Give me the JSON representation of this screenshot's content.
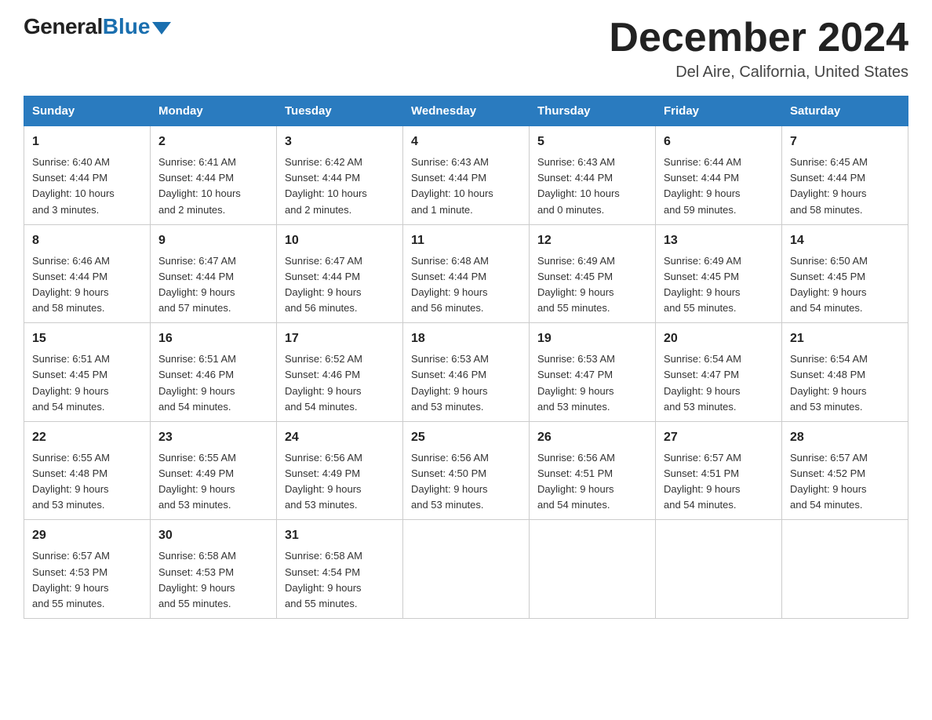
{
  "header": {
    "logo_general": "General",
    "logo_blue": "Blue",
    "month_title": "December 2024",
    "location": "Del Aire, California, United States"
  },
  "days_of_week": [
    "Sunday",
    "Monday",
    "Tuesday",
    "Wednesday",
    "Thursday",
    "Friday",
    "Saturday"
  ],
  "weeks": [
    [
      {
        "day": "1",
        "sunrise": "6:40 AM",
        "sunset": "4:44 PM",
        "daylight": "10 hours and 3 minutes."
      },
      {
        "day": "2",
        "sunrise": "6:41 AM",
        "sunset": "4:44 PM",
        "daylight": "10 hours and 2 minutes."
      },
      {
        "day": "3",
        "sunrise": "6:42 AM",
        "sunset": "4:44 PM",
        "daylight": "10 hours and 2 minutes."
      },
      {
        "day": "4",
        "sunrise": "6:43 AM",
        "sunset": "4:44 PM",
        "daylight": "10 hours and 1 minute."
      },
      {
        "day": "5",
        "sunrise": "6:43 AM",
        "sunset": "4:44 PM",
        "daylight": "10 hours and 0 minutes."
      },
      {
        "day": "6",
        "sunrise": "6:44 AM",
        "sunset": "4:44 PM",
        "daylight": "9 hours and 59 minutes."
      },
      {
        "day": "7",
        "sunrise": "6:45 AM",
        "sunset": "4:44 PM",
        "daylight": "9 hours and 58 minutes."
      }
    ],
    [
      {
        "day": "8",
        "sunrise": "6:46 AM",
        "sunset": "4:44 PM",
        "daylight": "9 hours and 58 minutes."
      },
      {
        "day": "9",
        "sunrise": "6:47 AM",
        "sunset": "4:44 PM",
        "daylight": "9 hours and 57 minutes."
      },
      {
        "day": "10",
        "sunrise": "6:47 AM",
        "sunset": "4:44 PM",
        "daylight": "9 hours and 56 minutes."
      },
      {
        "day": "11",
        "sunrise": "6:48 AM",
        "sunset": "4:44 PM",
        "daylight": "9 hours and 56 minutes."
      },
      {
        "day": "12",
        "sunrise": "6:49 AM",
        "sunset": "4:45 PM",
        "daylight": "9 hours and 55 minutes."
      },
      {
        "day": "13",
        "sunrise": "6:49 AM",
        "sunset": "4:45 PM",
        "daylight": "9 hours and 55 minutes."
      },
      {
        "day": "14",
        "sunrise": "6:50 AM",
        "sunset": "4:45 PM",
        "daylight": "9 hours and 54 minutes."
      }
    ],
    [
      {
        "day": "15",
        "sunrise": "6:51 AM",
        "sunset": "4:45 PM",
        "daylight": "9 hours and 54 minutes."
      },
      {
        "day": "16",
        "sunrise": "6:51 AM",
        "sunset": "4:46 PM",
        "daylight": "9 hours and 54 minutes."
      },
      {
        "day": "17",
        "sunrise": "6:52 AM",
        "sunset": "4:46 PM",
        "daylight": "9 hours and 54 minutes."
      },
      {
        "day": "18",
        "sunrise": "6:53 AM",
        "sunset": "4:46 PM",
        "daylight": "9 hours and 53 minutes."
      },
      {
        "day": "19",
        "sunrise": "6:53 AM",
        "sunset": "4:47 PM",
        "daylight": "9 hours and 53 minutes."
      },
      {
        "day": "20",
        "sunrise": "6:54 AM",
        "sunset": "4:47 PM",
        "daylight": "9 hours and 53 minutes."
      },
      {
        "day": "21",
        "sunrise": "6:54 AM",
        "sunset": "4:48 PM",
        "daylight": "9 hours and 53 minutes."
      }
    ],
    [
      {
        "day": "22",
        "sunrise": "6:55 AM",
        "sunset": "4:48 PM",
        "daylight": "9 hours and 53 minutes."
      },
      {
        "day": "23",
        "sunrise": "6:55 AM",
        "sunset": "4:49 PM",
        "daylight": "9 hours and 53 minutes."
      },
      {
        "day": "24",
        "sunrise": "6:56 AM",
        "sunset": "4:49 PM",
        "daylight": "9 hours and 53 minutes."
      },
      {
        "day": "25",
        "sunrise": "6:56 AM",
        "sunset": "4:50 PM",
        "daylight": "9 hours and 53 minutes."
      },
      {
        "day": "26",
        "sunrise": "6:56 AM",
        "sunset": "4:51 PM",
        "daylight": "9 hours and 54 minutes."
      },
      {
        "day": "27",
        "sunrise": "6:57 AM",
        "sunset": "4:51 PM",
        "daylight": "9 hours and 54 minutes."
      },
      {
        "day": "28",
        "sunrise": "6:57 AM",
        "sunset": "4:52 PM",
        "daylight": "9 hours and 54 minutes."
      }
    ],
    [
      {
        "day": "29",
        "sunrise": "6:57 AM",
        "sunset": "4:53 PM",
        "daylight": "9 hours and 55 minutes."
      },
      {
        "day": "30",
        "sunrise": "6:58 AM",
        "sunset": "4:53 PM",
        "daylight": "9 hours and 55 minutes."
      },
      {
        "day": "31",
        "sunrise": "6:58 AM",
        "sunset": "4:54 PM",
        "daylight": "9 hours and 55 minutes."
      },
      null,
      null,
      null,
      null
    ]
  ],
  "labels": {
    "sunrise": "Sunrise:",
    "sunset": "Sunset:",
    "daylight": "Daylight:"
  }
}
